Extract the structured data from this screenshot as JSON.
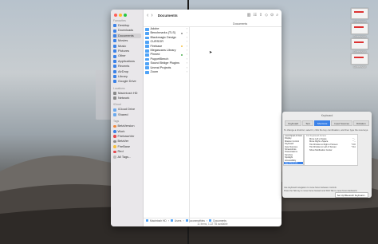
{
  "finder": {
    "title": "Documents",
    "column_header": "Documents",
    "sidebar": {
      "favorites_heading": "Favourites",
      "favorites": [
        "Desktop",
        "Downloads",
        "Documents",
        "Movies",
        "Music",
        "Pictures",
        "Other",
        "Applications",
        "Recents",
        "AirDrop",
        "Library",
        "Google Drive"
      ],
      "locations_heading": "Locations",
      "locations": [
        "Macintosh HD",
        "Network"
      ],
      "icloud_heading": "iCloud",
      "icloud": [
        "iCloud Drive",
        "Shared"
      ],
      "tags_heading": "Tags",
      "tags": [
        {
          "label": "BetaVersion",
          "color": "#f1873a"
        },
        {
          "label": "Work",
          "color": "#3b82e8"
        },
        {
          "label": "FirebaseVer",
          "color": "#e5484d"
        },
        {
          "label": "BetaVer",
          "color": "#8c8c8c"
        },
        {
          "label": "FireBase",
          "color": "#f6c141"
        },
        {
          "label": "Red",
          "color": "#e5484d"
        },
        {
          "label": "All Tags...",
          "color": "#bbbbbb"
        }
      ]
    },
    "files": [
      {
        "name": "Adobe",
        "tag": ""
      },
      {
        "name": "Benchmarks (TLS)",
        "tag": "#8c8c8c"
      },
      {
        "name": "Blackmagic Design",
        "tag": ""
      },
      {
        "name": "CURSOR",
        "tag": ""
      },
      {
        "name": "Firebase",
        "tag": "#f6c141"
      },
      {
        "name": "Megascans Library",
        "tag": ""
      },
      {
        "name": "Pinned",
        "tag": "#4caf50"
      },
      {
        "name": "PuppetBench",
        "tag": ""
      },
      {
        "name": "Sound Bridge Plugins",
        "tag": ""
      },
      {
        "name": "Unreal Projects",
        "tag": ""
      },
      {
        "name": "Zoom",
        "tag": ""
      }
    ],
    "path": [
      "Macintosh HD",
      "Users",
      "jaconmathieu",
      "Documents"
    ],
    "status": "11 items, 1.22 TB available"
  },
  "desktop_icons": [
    "Screenshot",
    "Screenshot",
    "Screenshot",
    "Screenshot"
  ],
  "keyboard": {
    "title": "Keyboard",
    "tabs": [
      "Keyboard",
      "Text",
      "Shortcuts",
      "Input Sources",
      "Dictation"
    ],
    "selected_tab": 2,
    "description": "To change a shortcut, select it, click the key combination, and then type the new keys.",
    "left_list": [
      "Launchpad & Dock",
      "Display",
      "Mission Control",
      "Keyboard",
      "Input Sources",
      "Screenshots",
      "Presentations",
      "Services",
      "Spotlight",
      "Accessibility",
      "App Shortcuts"
    ],
    "right_header": "Full Keyboard Access",
    "right_items": [
      {
        "label": "Move Left a Space",
        "key": "^←"
      },
      {
        "label": "Move Right a Space",
        "key": "^→"
      },
      {
        "label": "Tile Window to Right of Screen",
        "key": "^⌘D"
      },
      {
        "label": "Tile Window to Left of Screen",
        "key": "^⌘A"
      },
      {
        "label": "Show Notification Center",
        "key": ""
      }
    ],
    "footer": "Use keyboard navigation to move focus between controls",
    "footer2": "Press the Tab key to move focus forward and Shift Tab to move focus backward.",
    "button": "Set Up Bluetooth Keyboard..."
  }
}
